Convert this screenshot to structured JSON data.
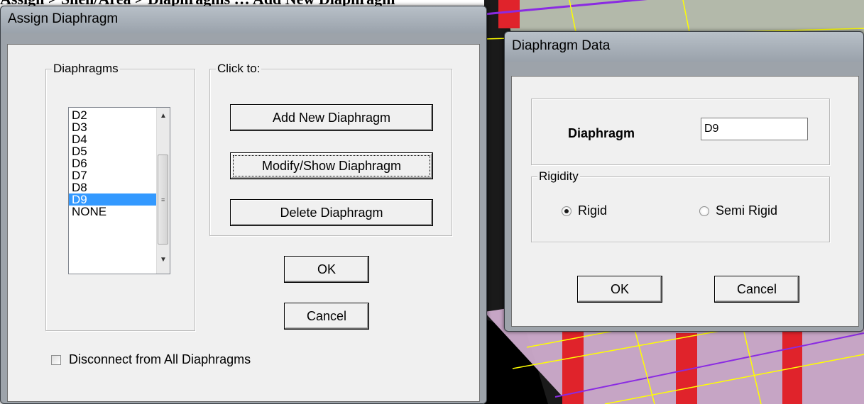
{
  "caption": "Assign > Shell/Area > Diaphragms … Add New Diaphragm",
  "assign_dialog": {
    "title": "Assign Diaphragm",
    "diaphragms_group": "Diaphragms",
    "items": [
      "D2",
      "D3",
      "D4",
      "D5",
      "D6",
      "D7",
      "D8",
      "D9",
      "NONE"
    ],
    "selected": "D9",
    "click_to_group": "Click to:",
    "add_label": "Add New Diaphragm",
    "modify_label": "Modify/Show Diaphragm",
    "delete_label": "Delete Diaphragm",
    "ok_label": "OK",
    "cancel_label": "Cancel",
    "disconnect_label": "Disconnect from All Diaphragms",
    "disconnect_checked": false
  },
  "data_dialog": {
    "title": "Diaphragm Data",
    "diaphragm_label": "Diaphragm",
    "diaphragm_value": "D9",
    "rigidity_group": "Rigidity",
    "rigid_label": "Rigid",
    "semi_rigid_label": "Semi Rigid",
    "selected_rigidity": "Rigid",
    "ok_label": "OK",
    "cancel_label": "Cancel"
  },
  "colors": {
    "selection": "#3399ff",
    "window_frame": "#9da3aa",
    "client": "#f0f0f0"
  }
}
